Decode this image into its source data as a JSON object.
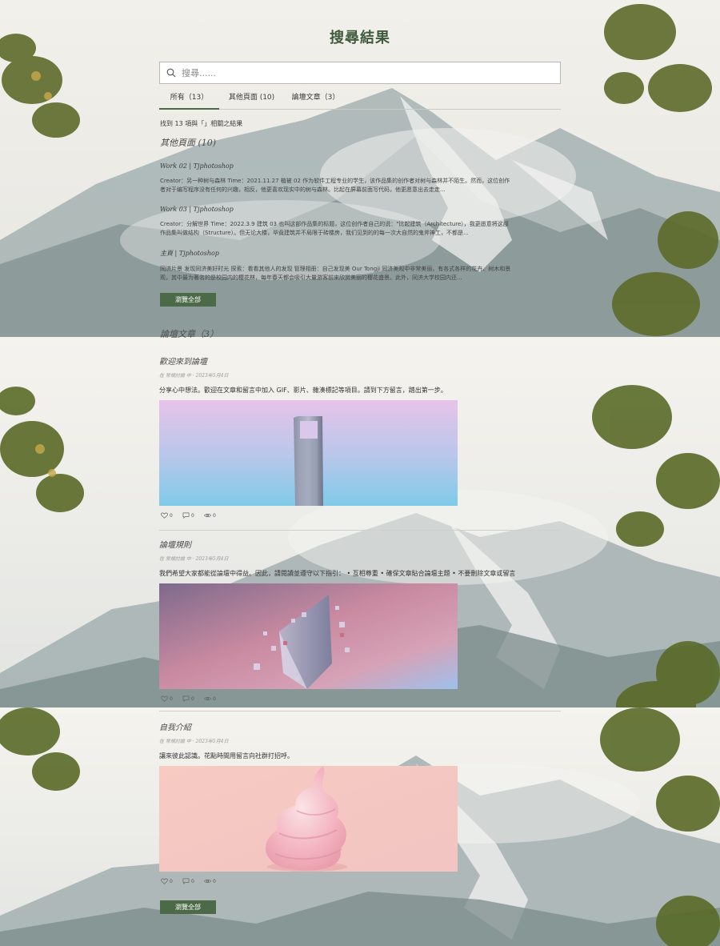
{
  "page_title": "搜尋結果",
  "search": {
    "placeholder": "搜尋......",
    "value": ""
  },
  "tabs": [
    {
      "label": "所有（13）",
      "active": true
    },
    {
      "label": "其他頁面 (10)",
      "active": false
    },
    {
      "label": "論壇文章（3）",
      "active": false
    }
  ],
  "results_count": "找到 13 項與「」相關之結果",
  "pages_section": {
    "heading": "其他頁面 (10)",
    "results": [
      {
        "title": "Work 02 | Tjphotoshop",
        "snippet": "Creator：另一种树与森林 Time：2021.11.27 植被 02 作为软件工程专业的学生，该作品集的创作者对树与森林并不陌生。然而，这位创作者对于编写程序没有任何的兴趣，相反，他更喜欢现实中的树与森林。比起在屏幕前面写代码，他更愿意出去走走..."
      },
      {
        "title": "Work 03 | Tjphotoshop",
        "snippet": "Creator：分解世界 Time：2022.3.9 建筑 03 也叫这部作品集的标题，这位创作者自己的说：\"比起建筑（Architecture），我更愿意将这部作品集叫做结构（Structure）。但无论大楼，毕竟建筑并不局限于砖楼房，我们见到的的每一次大自然的鬼斧神工，不都是..."
      },
      {
        "title": "主頁 | Tjphotoshop",
        "snippet": "同济片景 发现同济美好时光 探索：看看其他人的发现 管理相册：自己发现美 Our Tongji 同济美观中非常美丽，有各式各样的花卉、树木和景观，其中最为著名的是校园内的樱花林，每年春天都会吸引大量游客前来欣赏美丽的樱花盛景。此外，同济大学校园内还..."
      }
    ],
    "view_all": "瀏覽全部"
  },
  "posts_section": {
    "heading": "論壇文章（3）",
    "view_all": "瀏覽全部",
    "posts": [
      {
        "title": "歡迎來到論壇",
        "meta": "在 常規討論 中 · 2023年5月4日",
        "excerpt": "分享心中想法。歡迎在文章和留言中加入 GIF、影片、雜湊標記等項目。請到下方留言，踏出第一步。",
        "image": "tower-building-image",
        "likes": "0",
        "comments": "0",
        "views": "0"
      },
      {
        "title": "論壇規則",
        "meta": "在 常規討論 中 · 2023年5月4日",
        "excerpt": "我們希望大家都能從論壇中得益。因此，請閱讀並遵守以下指引： • 互相尊重 • 確保文章貼合論壇主題 • 不要刪除文章或留言",
        "image": "geometric-prism-image",
        "likes": "0",
        "comments": "0",
        "views": "0"
      },
      {
        "title": "自我介紹",
        "meta": "在 常規討論 中 · 2023年5月4日",
        "excerpt": "讓來彼此認識。花點時間用留言向社群打招呼。",
        "image": "soft-serve-image",
        "likes": "0",
        "comments": "0",
        "views": "0"
      }
    ]
  },
  "colors": {
    "accent": "#4c6a48",
    "title": "#3f5a3c",
    "background": "#f3f1ec"
  }
}
